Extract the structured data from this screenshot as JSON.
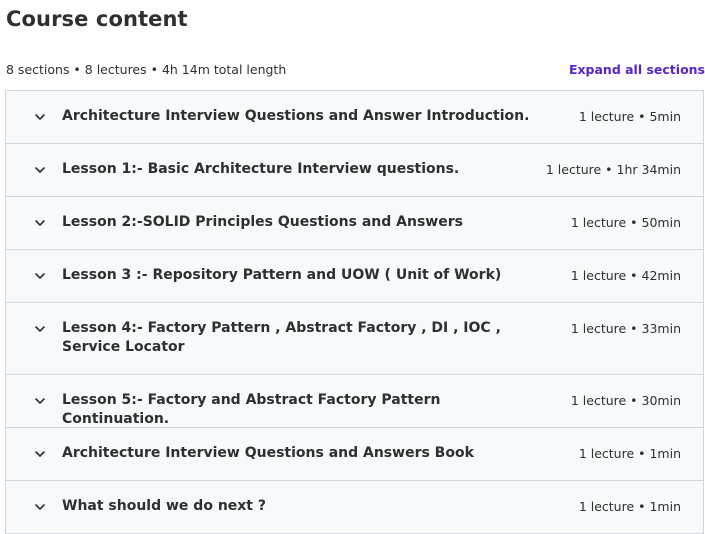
{
  "page": {
    "title": "Course content"
  },
  "summary": {
    "text": "8 sections • 8 lectures • 4h 14m total length",
    "expand_label": "Expand all sections"
  },
  "sections": [
    {
      "title": "Architecture Interview Questions and Answer Introduction.",
      "meta": "1 lecture • 5min",
      "icon": "chevron-down-icon"
    },
    {
      "title": "Lesson 1:- Basic Architecture Interview questions.",
      "meta": "1 lecture • 1hr 34min",
      "icon": "chevron-down-icon"
    },
    {
      "title": "Lesson 2:-SOLID Principles Questions and Answers",
      "meta": "1 lecture • 50min",
      "icon": "chevron-down-icon"
    },
    {
      "title": "Lesson 3 :- Repository Pattern and UOW ( Unit of Work)",
      "meta": "1 lecture • 42min",
      "icon": "chevron-down-icon"
    },
    {
      "title": "Lesson 4:- Factory Pattern , Abstract Factory , DI , IOC , Service Locator",
      "meta": "1 lecture • 33min",
      "icon": "chevron-down-icon"
    },
    {
      "title": "Lesson 5:- Factory and Abstract Factory Pattern Continuation.",
      "meta": "1 lecture • 30min",
      "icon": "chevron-down-icon"
    },
    {
      "title": "Architecture Interview Questions and Answers Book",
      "meta": "1 lecture • 1min",
      "icon": "chevron-down-icon"
    },
    {
      "title": "What should we do next ?",
      "meta": "1 lecture • 1min",
      "icon": "chevron-down-icon"
    }
  ],
  "colors": {
    "accent": "#5624d0",
    "text": "#2d2f31",
    "row_background": "#f7f9fa",
    "border": "#d1d7dc"
  }
}
